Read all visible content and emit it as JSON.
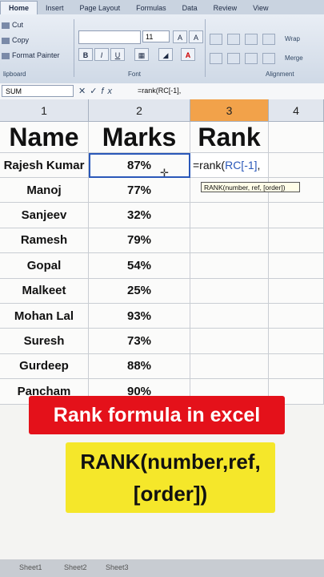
{
  "ribbon": {
    "tabs": [
      "Home",
      "Insert",
      "Page Layout",
      "Formulas",
      "Data",
      "Review",
      "View"
    ],
    "clipboard": {
      "cut": "Cut",
      "copy": "Copy",
      "format_painter": "Format Painter",
      "label": "lipboard"
    },
    "font_group_label": "Font",
    "alignment_group_label": "Alignment",
    "font_size": "11",
    "wrap_label": "Wrap",
    "merge_label": "Merge"
  },
  "formula_bar": {
    "name_box": "SUM",
    "formula": "=rank(RC[-1],"
  },
  "columns": [
    "1",
    "2",
    "3",
    "4"
  ],
  "headers": {
    "name": "Name",
    "marks": "Marks",
    "rank": "Rank"
  },
  "rows": [
    {
      "name": "Rajesh Kumar",
      "marks": "87%"
    },
    {
      "name": "Manoj",
      "marks": "77%"
    },
    {
      "name": "Sanjeev",
      "marks": "32%"
    },
    {
      "name": "Ramesh",
      "marks": "79%"
    },
    {
      "name": "Gopal",
      "marks": "54%"
    },
    {
      "name": "Malkeet",
      "marks": "25%"
    },
    {
      "name": "Mohan Lal",
      "marks": "93%"
    },
    {
      "name": "Suresh",
      "marks": "73%"
    },
    {
      "name": "Gurdeep",
      "marks": "88%"
    },
    {
      "name": "Pancham",
      "marks": "90%"
    }
  ],
  "editing_cell": {
    "prefix": "=rank(",
    "ref": "RC[-1]",
    "suffix": ","
  },
  "tooltip": "RANK(number, ref, [order])",
  "overlay": {
    "title": "Rank formula in excel",
    "syntax_line1": "RANK(number,ref,",
    "syntax_line2": "[order])"
  },
  "sheets": [
    "Sheet1",
    "Sheet2",
    "Sheet3"
  ],
  "colors": {
    "banner_red": "#e4111a",
    "banner_yellow": "#f5e72a",
    "selected_col": "#f2a24a"
  }
}
